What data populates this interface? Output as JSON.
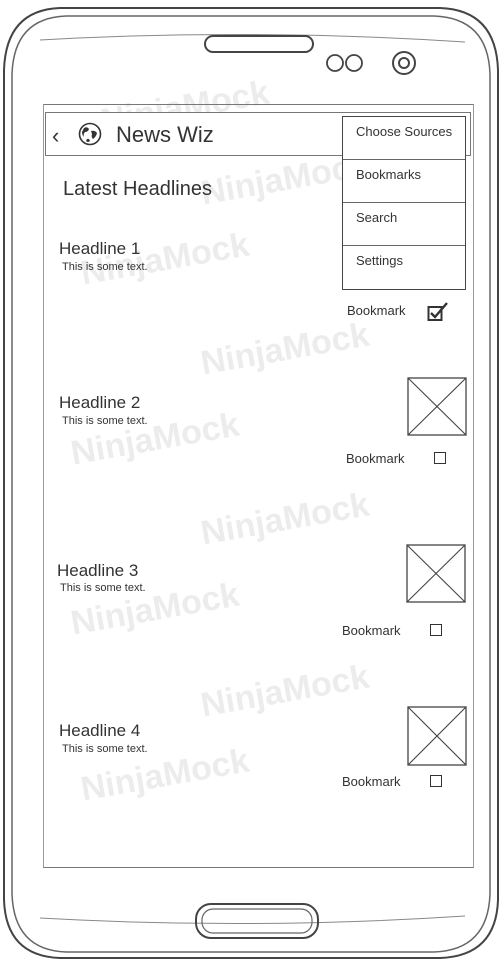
{
  "app": {
    "title": "News Wiz",
    "back_icon": "chevron-left-icon",
    "logo_icon": "globe-icon"
  },
  "section_title": "Latest Headlines",
  "menu": {
    "items": [
      "Choose Sources",
      "Bookmarks",
      "Search",
      "Settings"
    ]
  },
  "headlines": [
    {
      "title": "Headline 1",
      "text": "This is some text.",
      "bookmark_label": "Bookmark",
      "bookmarked": true
    },
    {
      "title": "Headline 2",
      "text": "This is some text.",
      "bookmark_label": "Bookmark",
      "bookmarked": false
    },
    {
      "title": "Headline 3",
      "text": "This is some text.",
      "bookmark_label": "Bookmark",
      "bookmarked": false
    },
    {
      "title": "Headline 4",
      "text": "This is some text.",
      "bookmark_label": "Bookmark",
      "bookmarked": false
    }
  ],
  "watermark": "NinjaMock"
}
